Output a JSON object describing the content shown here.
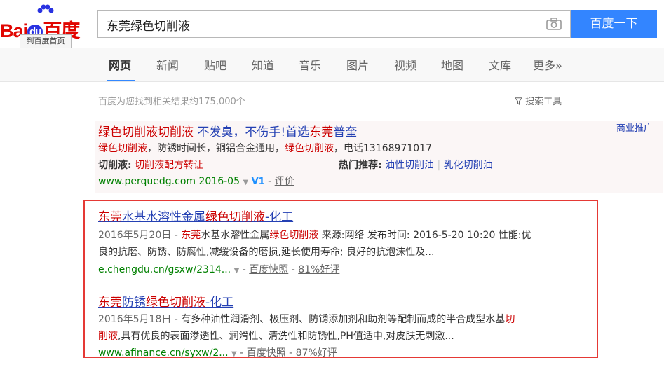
{
  "header": {
    "logo_text_bai": "Bai",
    "logo_text_du": "du",
    "logo_text_cn": "百度",
    "home_button": "到百度首页",
    "search_value": "东莞绿色切削液",
    "search_button": "百度一下"
  },
  "nav": [
    "网页",
    "新闻",
    "贴吧",
    "知道",
    "音乐",
    "图片",
    "视频",
    "地图",
    "文库",
    "更多»"
  ],
  "result_count": "百度为您找到相关结果约175,000个",
  "tools_label": "搜索工具",
  "ad_tag": "商业推广",
  "ad": {
    "title_parts": [
      "绿色切削液切削液",
      "不发臭，不伤手!首选",
      "东莞",
      "普奎"
    ],
    "desc_parts": [
      "绿色切削液",
      "，防锈时间长，铜铝合金通用，",
      "绿色切削液",
      "，电话13168971017"
    ],
    "line3_left_label": "切削液:",
    "line3_left_link": "切削液配方转让",
    "line3_right_label": "热门推荐:",
    "line3_right_links": [
      "油性切削油",
      "乳化切削油"
    ],
    "url": "www.perquedg.com",
    "date": "2016-05",
    "v_badge": "V1",
    "review": "评价"
  },
  "results": [
    {
      "title_parts": [
        "东莞",
        "水基水溶性金属",
        "绿色切削液",
        "-化工"
      ],
      "date": "2016年5月20日 - ",
      "line1_parts": [
        "东莞",
        "水基水溶性金属",
        "绿色切削液",
        " 来源:网络 发布时间: 2016-5-20 10:20 性能:优"
      ],
      "line2": "良的抗磨、防锈、防腐性,减缓设备的磨损,延长使用寿命; 良好的抗泡沫性及...",
      "url": "e.chengdu.cn/gsxw/2314...",
      "snapshot": "百度快照",
      "rating": "81%好评"
    },
    {
      "title_parts": [
        "东莞",
        "防锈",
        "绿色切削液",
        "-化工"
      ],
      "date": "2016年5月18日 - ",
      "line1_parts": [
        "有多种油性润滑剂、极压剂、防锈添加剂和助剂等配制而成的半合成型水基",
        "切"
      ],
      "line2_parts": [
        "削液",
        ",具有优良的表面渗透性、润滑性、清洗性和防锈性,PH值适中,对皮肤无刺激..."
      ],
      "url": "www.afinance.cn/syxw/2...",
      "snapshot": "百度快照",
      "rating": "87%好评"
    }
  ]
}
